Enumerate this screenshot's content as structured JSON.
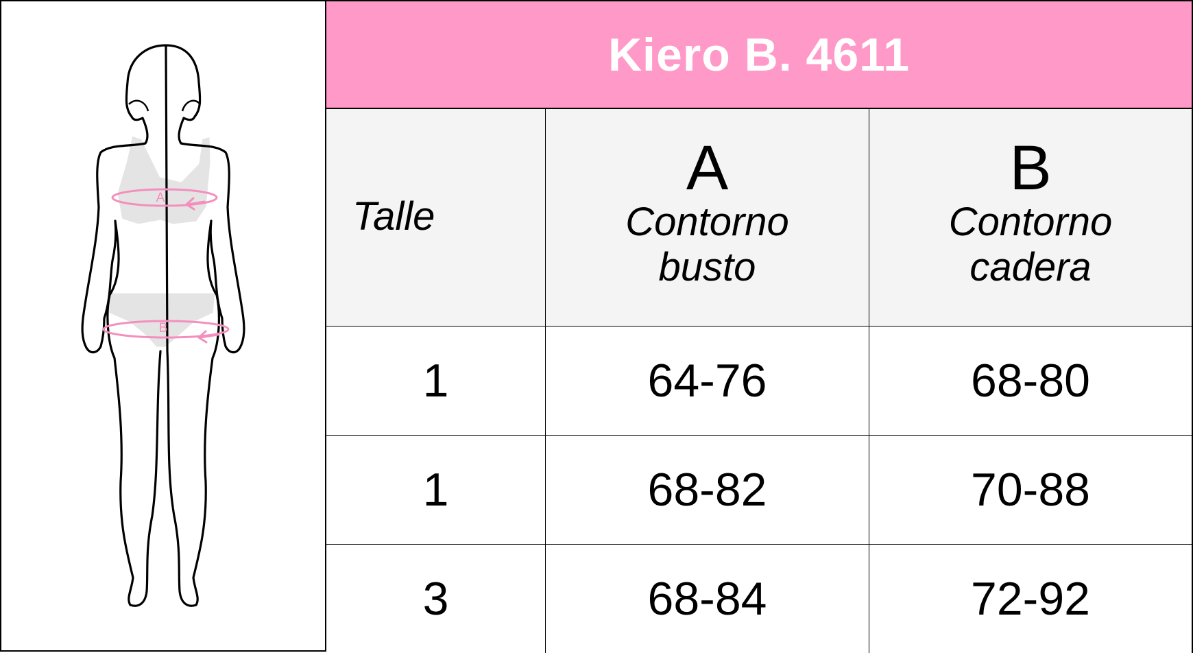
{
  "title": "Kiero B. 4611",
  "figure": {
    "marker_a": "A",
    "marker_b": "B"
  },
  "table": {
    "header": {
      "size_label": "Talle",
      "col_a_letter": "A",
      "col_a_name_line1": "Contorno",
      "col_a_name_line2": "busto",
      "col_b_letter": "B",
      "col_b_name_line1": "Contorno",
      "col_b_name_line2": "cadera"
    },
    "rows": [
      {
        "size": "1",
        "bust": "64-76",
        "hip": "68-80"
      },
      {
        "size": "1",
        "bust": "68-82",
        "hip": "70-88"
      },
      {
        "size": "3",
        "bust": "68-84",
        "hip": "72-92"
      }
    ]
  },
  "colors": {
    "title_background": "#ff99c8",
    "title_text": "#ffffff",
    "header_background": "#f4f4f4",
    "measure_lines": "#f48fbd"
  }
}
